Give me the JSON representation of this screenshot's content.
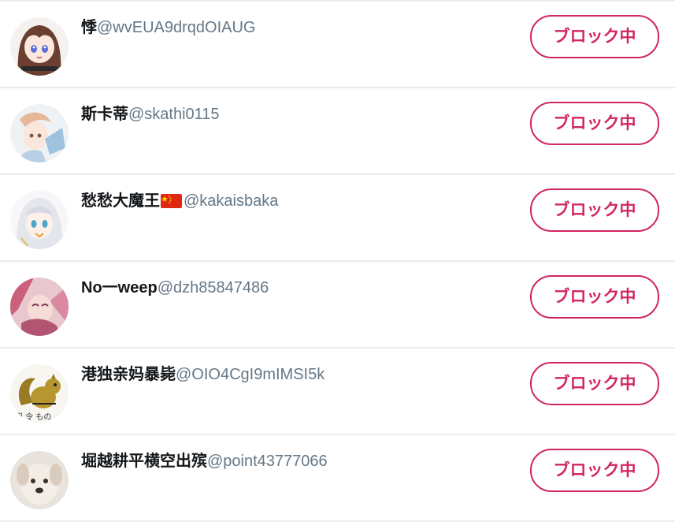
{
  "colors": {
    "accent": "#d0265f",
    "name": "#14171a",
    "handle": "#657786",
    "divider": "#e6ecf0"
  },
  "users": [
    {
      "display_name": "悸",
      "screen_name": "@wvEUA9drqdOIAUG",
      "flag": "",
      "button_label": "ブロック中",
      "avatar_icon": "anime-girl-avatar-icon"
    },
    {
      "display_name": "斯卡蒂",
      "screen_name": "@skathi0115",
      "flag": "",
      "button_label": "ブロック中",
      "avatar_icon": "anime-sketch-avatar-icon"
    },
    {
      "display_name": "愁愁大魔王",
      "screen_name": "@kakaisbaka",
      "flag": "china-flag-icon",
      "button_label": "ブロック中",
      "avatar_icon": "white-hair-anime-avatar-icon"
    },
    {
      "display_name": "No一weep",
      "screen_name": "@dzh85847486",
      "flag": "",
      "button_label": "ブロック中",
      "avatar_icon": "pink-anime-avatar-icon"
    },
    {
      "display_name": "港独亲妈暴毙",
      "screen_name": "@OIO4CgI9mIMSI5k",
      "flag": "",
      "button_label": "ブロック中",
      "avatar_icon": "squirrel-avatar-icon"
    },
    {
      "display_name": "堀越耕平横空出殡",
      "screen_name": "@point43777066",
      "flag": "",
      "button_label": "ブロック中",
      "avatar_icon": "dog-avatar-icon"
    }
  ]
}
